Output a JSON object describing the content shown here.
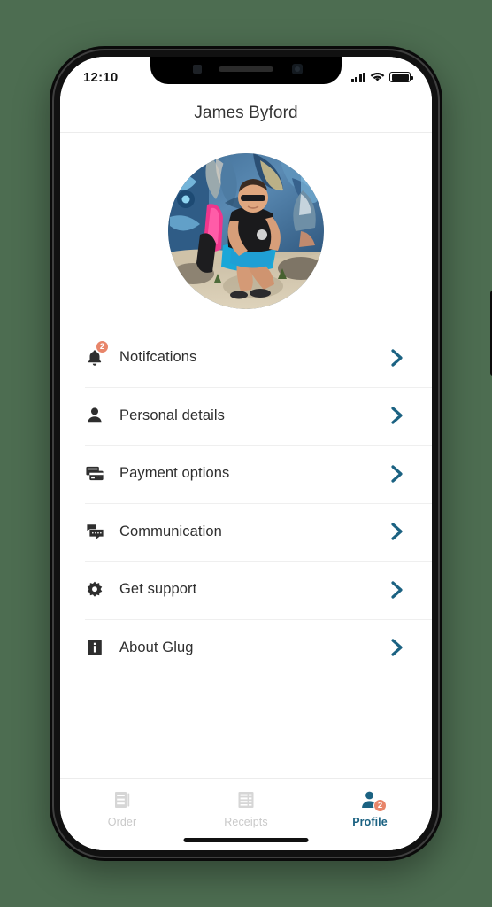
{
  "background": {
    "color": "#4d6d51"
  },
  "device": {
    "name": "iphone-x",
    "buttons": [
      "silent-switch",
      "volume-up",
      "volume-down",
      "power"
    ],
    "home_indicator": true
  },
  "status_bar": {
    "time": "12:10",
    "signal_icon": "signal-bars-icon",
    "signal_bars": 4,
    "wifi_icon": "wifi-icon",
    "battery_icon": "battery-full-icon",
    "battery_level": 100
  },
  "header": {
    "title": "James Byford"
  },
  "avatar": {
    "name": "profile-photo",
    "alt": "Man sitting on sand in front of a colourful graffiti mural"
  },
  "menu": {
    "items": [
      {
        "id": "notifications",
        "label": "Notifcations",
        "icon": "bell-icon",
        "badge": "2",
        "chevron": "chevron-right-icon"
      },
      {
        "id": "personal-details",
        "label": "Personal details",
        "icon": "person-icon",
        "badge": null,
        "chevron": "chevron-right-icon"
      },
      {
        "id": "payment-options",
        "label": "Payment options",
        "icon": "credit-cards-icon",
        "badge": null,
        "chevron": "chevron-right-icon"
      },
      {
        "id": "communication",
        "label": "Communication",
        "icon": "chat-bubbles-icon",
        "badge": null,
        "chevron": "chevron-right-icon"
      },
      {
        "id": "get-support",
        "label": "Get support",
        "icon": "gear-icon",
        "badge": null,
        "chevron": "chevron-right-icon"
      },
      {
        "id": "about-glug",
        "label": "About Glug",
        "icon": "info-square-icon",
        "badge": null,
        "chevron": "chevron-right-icon"
      }
    ]
  },
  "tabbar": {
    "items": [
      {
        "id": "order",
        "label": "Order",
        "icon": "order-list-icon",
        "active": false,
        "badge": null
      },
      {
        "id": "receipts",
        "label": "Receipts",
        "icon": "receipt-grid-icon",
        "active": false,
        "badge": null
      },
      {
        "id": "profile",
        "label": "Profile",
        "icon": "person-icon",
        "active": true,
        "badge": "2"
      }
    ]
  },
  "colors": {
    "accent": "#1b6282",
    "badge": "#e8856a",
    "text": "#2e2e2e",
    "muted": "#c9c9c9",
    "divider": "#efefef",
    "surface": "#ffffff"
  }
}
